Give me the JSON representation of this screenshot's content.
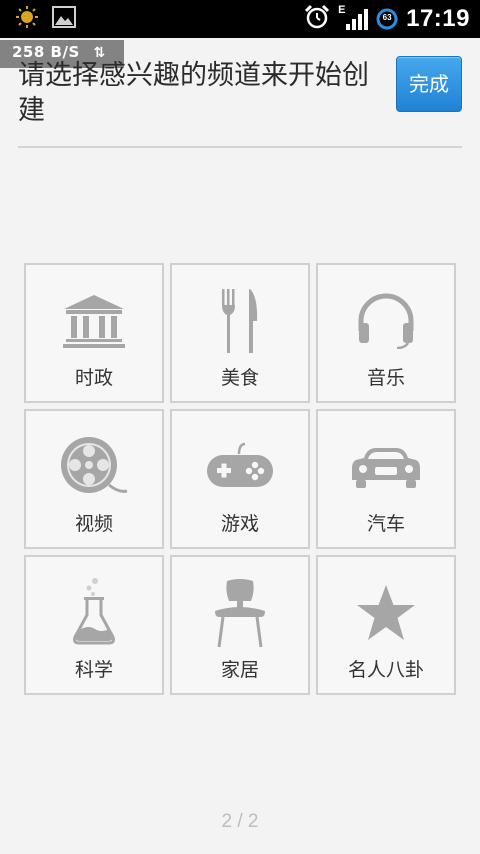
{
  "status_bar": {
    "time": "17:19",
    "battery_level": "63",
    "network_type": "E",
    "icons": [
      "sun-icon",
      "image-icon",
      "alarm-icon",
      "signal-icon",
      "battery-icon"
    ]
  },
  "net_speed": {
    "value": "258 B/S",
    "arrows": "⇅"
  },
  "header": {
    "title": "请选择感兴趣的频道来开始创建",
    "done_label": "完成"
  },
  "channels": [
    {
      "label": "时政",
      "icon": "government-building-icon"
    },
    {
      "label": "美食",
      "icon": "fork-knife-icon"
    },
    {
      "label": "音乐",
      "icon": "headphones-icon"
    },
    {
      "label": "视频",
      "icon": "film-reel-icon"
    },
    {
      "label": "游戏",
      "icon": "gamepad-icon"
    },
    {
      "label": "汽车",
      "icon": "car-icon"
    },
    {
      "label": "科学",
      "icon": "flask-icon"
    },
    {
      "label": "家居",
      "icon": "chair-icon"
    },
    {
      "label": "名人八卦",
      "icon": "star-icon"
    }
  ],
  "pagination": {
    "text": "2 / 2"
  },
  "colors": {
    "accent": "#2a8fe0",
    "icon_gray": "#a6a6a6",
    "tile_border": "#cfcfcf"
  }
}
